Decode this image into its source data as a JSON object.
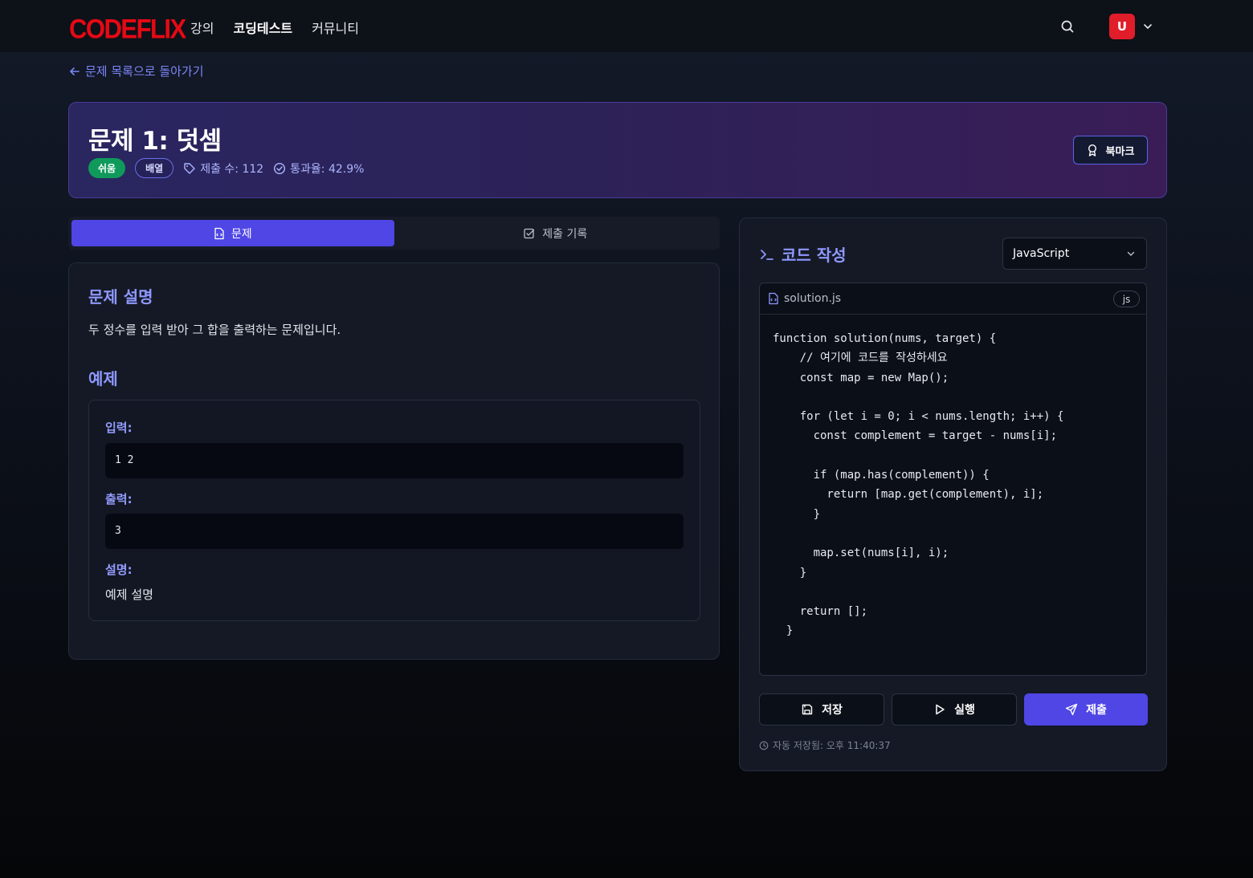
{
  "header": {
    "logo": "CODEFLIX",
    "nav": [
      "강의",
      "코딩테스트",
      "커뮤니티"
    ],
    "active_nav": "코딩테스트",
    "avatar_initial": "U"
  },
  "back_link": "문제 목록으로 돌아가기",
  "problem": {
    "title": "문제 1: 덧셈",
    "difficulty": "쉬움",
    "tag": "배열",
    "submissions": "제출 수: 112",
    "pass_rate": "통과율: 42.9%",
    "bookmark_label": "북마크"
  },
  "tabs": [
    "문제",
    "제출 기록"
  ],
  "description": {
    "heading": "문제 설명",
    "text": "두 정수를 입력 받아 그 합을 출력하는 문제입니다."
  },
  "example": {
    "heading": "예제",
    "input_label": "입력:",
    "input": "1 2",
    "output_label": "출력:",
    "output": "3",
    "explain_label": "설명:",
    "explain": "예제 설명"
  },
  "editor": {
    "heading": "코드 작성",
    "language": "JavaScript",
    "filename": "solution.js",
    "file_badge": "js",
    "code": "function solution(nums, target) {\n    // 여기에 코드를 작성하세요\n    const map = new Map();\n\n    for (let i = 0; i < nums.length; i++) {\n      const complement = target - nums[i];\n\n      if (map.has(complement)) {\n        return [map.get(complement), i];\n      }\n\n      map.set(nums[i], i);\n    }\n\n    return [];\n  }",
    "save_label": "저장",
    "run_label": "실행",
    "submit_label": "제출",
    "autosave": "자동 저장됨: 오후 11:40:37"
  },
  "colors": {
    "accent": "#4f46e5",
    "logo": "#e50914",
    "easy": "#0f9a5c",
    "heading": "#8f98ff"
  }
}
